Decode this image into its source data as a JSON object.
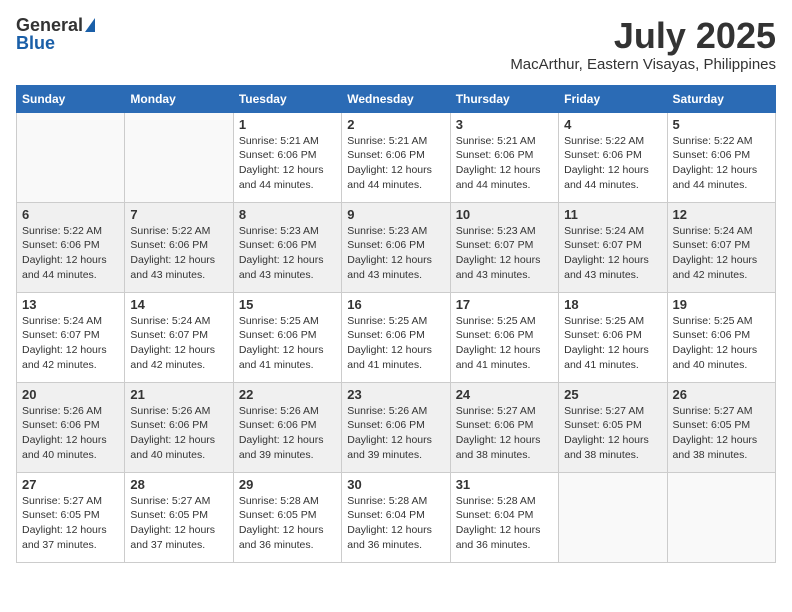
{
  "logo": {
    "general": "General",
    "blue": "Blue"
  },
  "title": {
    "month": "July 2025",
    "location": "MacArthur, Eastern Visayas, Philippines"
  },
  "headers": [
    "Sunday",
    "Monday",
    "Tuesday",
    "Wednesday",
    "Thursday",
    "Friday",
    "Saturday"
  ],
  "weeks": [
    [
      {
        "day": "",
        "info": ""
      },
      {
        "day": "",
        "info": ""
      },
      {
        "day": "1",
        "info": "Sunrise: 5:21 AM\nSunset: 6:06 PM\nDaylight: 12 hours and 44 minutes."
      },
      {
        "day": "2",
        "info": "Sunrise: 5:21 AM\nSunset: 6:06 PM\nDaylight: 12 hours and 44 minutes."
      },
      {
        "day": "3",
        "info": "Sunrise: 5:21 AM\nSunset: 6:06 PM\nDaylight: 12 hours and 44 minutes."
      },
      {
        "day": "4",
        "info": "Sunrise: 5:22 AM\nSunset: 6:06 PM\nDaylight: 12 hours and 44 minutes."
      },
      {
        "day": "5",
        "info": "Sunrise: 5:22 AM\nSunset: 6:06 PM\nDaylight: 12 hours and 44 minutes."
      }
    ],
    [
      {
        "day": "6",
        "info": "Sunrise: 5:22 AM\nSunset: 6:06 PM\nDaylight: 12 hours and 44 minutes."
      },
      {
        "day": "7",
        "info": "Sunrise: 5:22 AM\nSunset: 6:06 PM\nDaylight: 12 hours and 43 minutes."
      },
      {
        "day": "8",
        "info": "Sunrise: 5:23 AM\nSunset: 6:06 PM\nDaylight: 12 hours and 43 minutes."
      },
      {
        "day": "9",
        "info": "Sunrise: 5:23 AM\nSunset: 6:06 PM\nDaylight: 12 hours and 43 minutes."
      },
      {
        "day": "10",
        "info": "Sunrise: 5:23 AM\nSunset: 6:07 PM\nDaylight: 12 hours and 43 minutes."
      },
      {
        "day": "11",
        "info": "Sunrise: 5:24 AM\nSunset: 6:07 PM\nDaylight: 12 hours and 43 minutes."
      },
      {
        "day": "12",
        "info": "Sunrise: 5:24 AM\nSunset: 6:07 PM\nDaylight: 12 hours and 42 minutes."
      }
    ],
    [
      {
        "day": "13",
        "info": "Sunrise: 5:24 AM\nSunset: 6:07 PM\nDaylight: 12 hours and 42 minutes."
      },
      {
        "day": "14",
        "info": "Sunrise: 5:24 AM\nSunset: 6:07 PM\nDaylight: 12 hours and 42 minutes."
      },
      {
        "day": "15",
        "info": "Sunrise: 5:25 AM\nSunset: 6:06 PM\nDaylight: 12 hours and 41 minutes."
      },
      {
        "day": "16",
        "info": "Sunrise: 5:25 AM\nSunset: 6:06 PM\nDaylight: 12 hours and 41 minutes."
      },
      {
        "day": "17",
        "info": "Sunrise: 5:25 AM\nSunset: 6:06 PM\nDaylight: 12 hours and 41 minutes."
      },
      {
        "day": "18",
        "info": "Sunrise: 5:25 AM\nSunset: 6:06 PM\nDaylight: 12 hours and 41 minutes."
      },
      {
        "day": "19",
        "info": "Sunrise: 5:25 AM\nSunset: 6:06 PM\nDaylight: 12 hours and 40 minutes."
      }
    ],
    [
      {
        "day": "20",
        "info": "Sunrise: 5:26 AM\nSunset: 6:06 PM\nDaylight: 12 hours and 40 minutes."
      },
      {
        "day": "21",
        "info": "Sunrise: 5:26 AM\nSunset: 6:06 PM\nDaylight: 12 hours and 40 minutes."
      },
      {
        "day": "22",
        "info": "Sunrise: 5:26 AM\nSunset: 6:06 PM\nDaylight: 12 hours and 39 minutes."
      },
      {
        "day": "23",
        "info": "Sunrise: 5:26 AM\nSunset: 6:06 PM\nDaylight: 12 hours and 39 minutes."
      },
      {
        "day": "24",
        "info": "Sunrise: 5:27 AM\nSunset: 6:06 PM\nDaylight: 12 hours and 38 minutes."
      },
      {
        "day": "25",
        "info": "Sunrise: 5:27 AM\nSunset: 6:05 PM\nDaylight: 12 hours and 38 minutes."
      },
      {
        "day": "26",
        "info": "Sunrise: 5:27 AM\nSunset: 6:05 PM\nDaylight: 12 hours and 38 minutes."
      }
    ],
    [
      {
        "day": "27",
        "info": "Sunrise: 5:27 AM\nSunset: 6:05 PM\nDaylight: 12 hours and 37 minutes."
      },
      {
        "day": "28",
        "info": "Sunrise: 5:27 AM\nSunset: 6:05 PM\nDaylight: 12 hours and 37 minutes."
      },
      {
        "day": "29",
        "info": "Sunrise: 5:28 AM\nSunset: 6:05 PM\nDaylight: 12 hours and 36 minutes."
      },
      {
        "day": "30",
        "info": "Sunrise: 5:28 AM\nSunset: 6:04 PM\nDaylight: 12 hours and 36 minutes."
      },
      {
        "day": "31",
        "info": "Sunrise: 5:28 AM\nSunset: 6:04 PM\nDaylight: 12 hours and 36 minutes."
      },
      {
        "day": "",
        "info": ""
      },
      {
        "day": "",
        "info": ""
      }
    ]
  ]
}
